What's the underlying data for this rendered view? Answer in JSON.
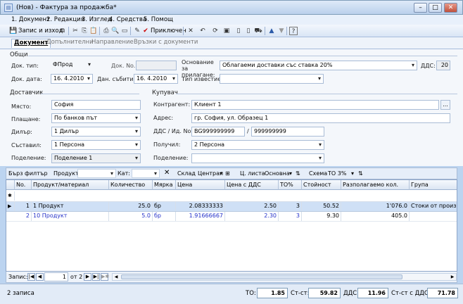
{
  "window": {
    "title": "(Нов) - Фактура за продажба*"
  },
  "menu": [
    "1. Документ",
    "2. Редакция",
    "3. Изглед",
    "4. Средства",
    "5. Помощ"
  ],
  "toolbar": {
    "save_close": "Запис и изход",
    "post": "Приключен"
  },
  "tabs": [
    "Документ",
    "Допълнителни",
    "Направление",
    "Връзки с документи"
  ],
  "general": {
    "group": "Общи",
    "doc_type_label": "Док. тип:",
    "doc_type": "ФПрод",
    "doc_no_label": "Док. No.",
    "doc_no": "",
    "doc_date_label": "Док. дата:",
    "doc_date": "16. 4.2010",
    "tax_event_label": "Дан. събитие:",
    "tax_event": "16. 4.2010",
    "basis_label": "Основание за прилагане:",
    "basis": "Облагаеми доставки със ставка 20%",
    "notice_label": "Тип известие:",
    "notice": "",
    "vat_label": "ДДС:",
    "vat": "20"
  },
  "supplier": {
    "group": "Доставчик",
    "place_label": "Място:",
    "place": "София",
    "payment_label": "Плащане:",
    "payment": "По банков път",
    "dealer_label": "Дилър:",
    "dealer": "1 Дилър",
    "creator_label": "Съставил:",
    "creator": "1 Персона",
    "division_label": "Поделение:",
    "division": "Поделение 1"
  },
  "buyer": {
    "group": "Купувач",
    "partner_label": "Контрагент:",
    "partner": "Клиент 1",
    "browse": "...",
    "address_label": "Адрес:",
    "address": "гр. София, ул. Образец 1",
    "vat_id_label": "ДДС / Ид. No.",
    "vat_no": "BG999999999",
    "id_sep": "/",
    "id_no": "999999999",
    "receiver_label": "Получил:",
    "receiver": "2 Персона",
    "division_label": "Поделение:",
    "division": ""
  },
  "filter": {
    "quick": "Бърз филтър",
    "product_label": "Продукт:",
    "cat_label": "Кат:",
    "store_label": "Склад",
    "store": "Централ",
    "price_list_label": "Ц. листа",
    "price_list": "Основна",
    "scheme_label": "Схема",
    "scheme": "ТО 3%"
  },
  "grid": {
    "columns": [
      "No.",
      "Продукт/материал",
      "Количество",
      "Мярка",
      "Цена",
      "Цена с ДДС",
      "ТО%",
      "Стойност",
      "Разполагаемо кол.",
      "Група"
    ],
    "new_row_marker": "✱",
    "rows": [
      [
        "1",
        "1 Продукт",
        "25.0",
        "бр",
        "2.08333333",
        "2.50",
        "3",
        "50.52",
        "1'076.0",
        "Стоки от производ"
      ],
      [
        "2",
        "10 Продукт",
        "5.0",
        "бр",
        "1.91666667",
        "2.30",
        "3",
        "9.30",
        "405.0",
        ""
      ]
    ]
  },
  "navigator": {
    "record_label": "Запис:",
    "current": "1",
    "of": "от 2"
  },
  "status": {
    "records": "2 записа",
    "to_label": "ТО:",
    "to": "1.85",
    "cost_label": "Ст-ст:",
    "cost": "59.82",
    "vat_label": "ДДС:",
    "vat": "11.96",
    "total_label": "Ст-ст с ДДС:",
    "total": "71.78"
  },
  "colors": {
    "accent": "#2330c9",
    "selection": "#cfe0f6"
  }
}
